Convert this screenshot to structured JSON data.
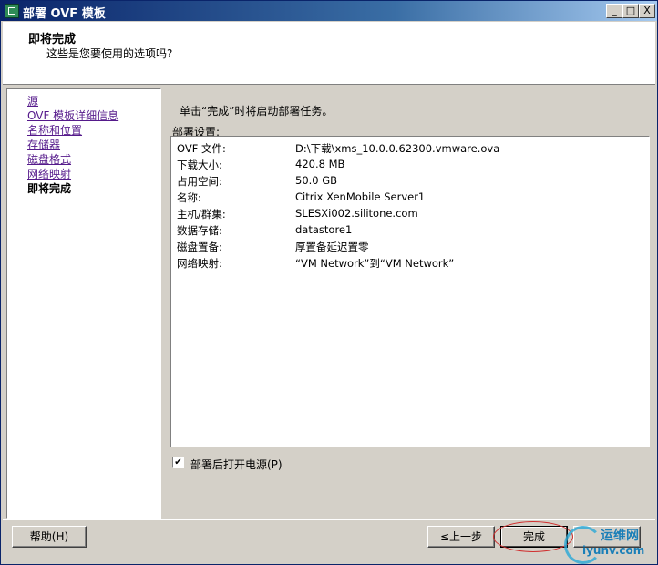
{
  "window": {
    "title": "部署 OVF 模板",
    "controls": {
      "minimize": "_",
      "maximize": "□",
      "close": "X"
    }
  },
  "header": {
    "title": "即将完成",
    "subtitle": "这些是您要使用的选项吗?"
  },
  "nav": {
    "items": [
      {
        "label": "源"
      },
      {
        "label": "OVF 模板详细信息"
      },
      {
        "label": "名称和位置"
      },
      {
        "label": "存储器"
      },
      {
        "label": "磁盘格式"
      },
      {
        "label": "网络映射"
      }
    ],
    "current": "即将完成"
  },
  "main": {
    "hint": "单击“完成”时将启动部署任务。",
    "settings_label": "部署设置:",
    "rows": [
      {
        "label": "OVF 文件:",
        "value": "D:\\下载\\xms_10.0.0.62300.vmware.ova"
      },
      {
        "label": "下载大小:",
        "value": "420.8 MB"
      },
      {
        "label": "占用空间:",
        "value": "50.0 GB"
      },
      {
        "label": "名称:",
        "value": "Citrix XenMobile Server1"
      },
      {
        "label": "主机/群集:",
        "value": "SLESXi002.silitone.com"
      },
      {
        "label": "数据存储:",
        "value": "datastore1"
      },
      {
        "label": "磁盘置备:",
        "value": "厚置备延迟置零"
      },
      {
        "label": "网络映射:",
        "value": "“VM Network”到“VM Network”"
      }
    ],
    "power_on": {
      "label": "部署后打开电源(P)",
      "checked": true,
      "mark": "✔"
    }
  },
  "buttons": {
    "help": "帮助(H)",
    "back": "≤上一步",
    "finish": "完成"
  },
  "watermark": {
    "cn": "运维网",
    "en": "iyunv.com"
  },
  "colors": {
    "titlebar_start": "#0a246a",
    "titlebar_end": "#a6caf0",
    "link": "#551a8b",
    "annotation_ring": "#d03030"
  }
}
